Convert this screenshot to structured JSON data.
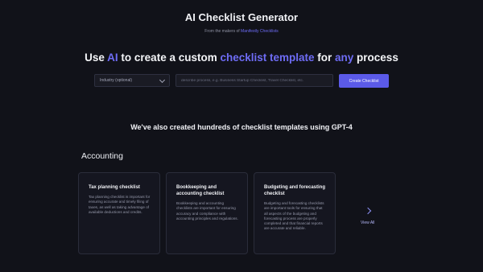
{
  "header": {
    "title": "AI Checklist Generator",
    "subtitle_prefix": "From the makers of",
    "subtitle_link": "Manifestly Checklists"
  },
  "hero": {
    "part1": "Use ",
    "ai": "AI",
    "part2": " to create a custom ",
    "checklist_template": "checklist template",
    "part3": " for ",
    "any": "any",
    "part4": " process"
  },
  "form": {
    "industry_label": "Industry (optional)",
    "describe_placeholder": "describe process, e.g. Business Startup Checklist, Travel Checklist, etc.",
    "create_label": "Create Checklist"
  },
  "templates_heading": "We've also created hundreds of checklist templates using GPT-4",
  "category": {
    "name": "Accounting",
    "view_all": "View All",
    "cards": [
      {
        "title": "Tax planning checklist",
        "description": "Tax planning checklist is important for ensuring accurate and timely filing of taxes, as well as taking advantage of available deductions and credits."
      },
      {
        "title": "Bookkeeping and accounting checklist",
        "description": "Bookkeeping and accounting checklists are important for ensuring accuracy and compliance with accounting principles and regulations."
      },
      {
        "title": "Budgeting and forecasting checklist",
        "description": "Budgeting and forecasting checklists are important tools for ensuring that all aspects of the budgeting and forecasting process are properly completed and that financial reports are accurate and reliable."
      }
    ]
  },
  "colors": {
    "background": "#111219",
    "accent": "#5b5ae8",
    "highlight": "#6e6cf5"
  }
}
